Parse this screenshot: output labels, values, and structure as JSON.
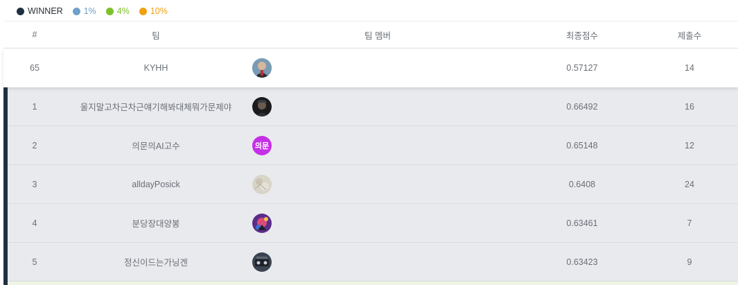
{
  "legend": [
    {
      "label": "WINNER",
      "color": "#1f3042",
      "text_color": "#2b2f35"
    },
    {
      "label": "1%",
      "color": "#6fa1c9",
      "text_color": "#6fa1c9"
    },
    {
      "label": "4%",
      "color": "#7cc12a",
      "text_color": "#7cc12a"
    },
    {
      "label": "10%",
      "color": "#f0a014",
      "text_color": "#f0a014"
    }
  ],
  "header": {
    "rank": "#",
    "team": "팀",
    "members": "팀 멤버",
    "score": "최종점수",
    "submissions": "제출수"
  },
  "my_row": {
    "rank": "65",
    "team": "KYHH",
    "score": "0.57127",
    "submissions": "14",
    "avatar": "user-photo-avatar"
  },
  "rows": [
    {
      "rank": "1",
      "team": "울지말고차근차근얘기해봐대체뭐가문제야",
      "score": "0.66492",
      "submissions": "16",
      "avatar": "user-photo-avatar"
    },
    {
      "rank": "2",
      "team": "의문의AI고수",
      "score": "0.65148",
      "submissions": "12",
      "avatar_text": "의문",
      "avatar_color": "#c530e6"
    },
    {
      "rank": "3",
      "team": "alldayPosick",
      "score": "0.6408",
      "submissions": "24",
      "avatar": "user-photo-avatar"
    },
    {
      "rank": "4",
      "team": "분당장대양봉",
      "score": "0.63461",
      "submissions": "7",
      "avatar": "user-photo-avatar"
    },
    {
      "rank": "5",
      "team": "정신이드는가닝겐",
      "score": "0.63423",
      "submissions": "9",
      "avatar": "user-photo-avatar"
    }
  ]
}
